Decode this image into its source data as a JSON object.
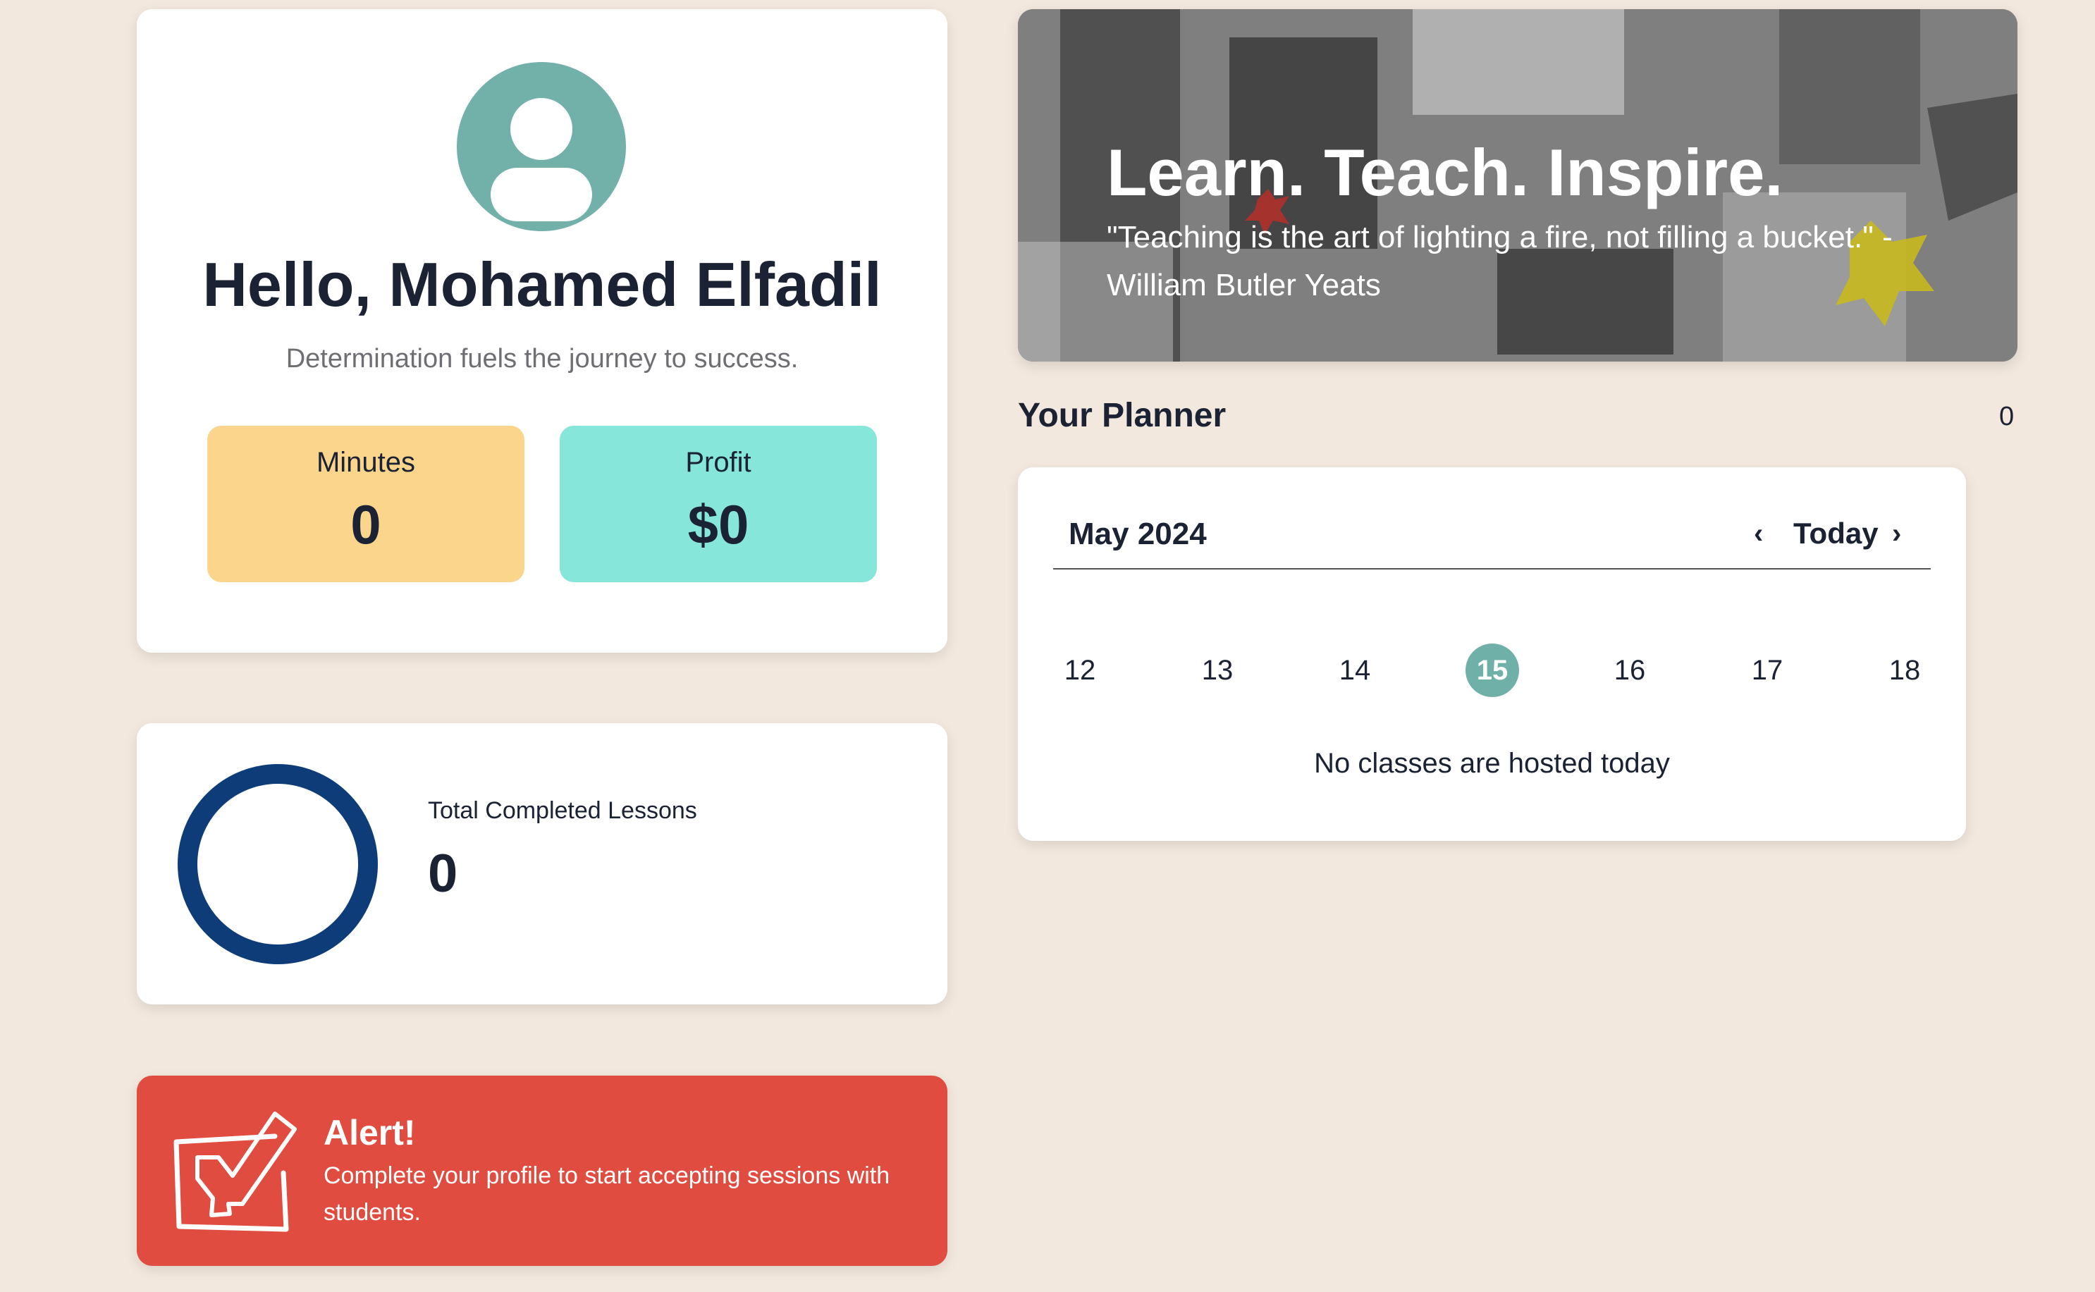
{
  "profile": {
    "greeting": "Hello, Mohamed Elfadil",
    "motto": "Determination fuels the journey to success.",
    "avatar_icon": "user-avatar-icon",
    "stats": [
      {
        "label": "Minutes",
        "value": "0",
        "color": "#fbd58c"
      },
      {
        "label": "Profit",
        "value": "$0",
        "color": "#86e6da"
      }
    ]
  },
  "lessons": {
    "title": "Total Completed Lessons",
    "value": "0",
    "progress": 0,
    "ring_color": "#0d3c78"
  },
  "alert": {
    "title": "Alert!",
    "text": "Complete your profile to start accepting sessions with students.",
    "icon": "edit-checkbox-icon",
    "color": "#e04d40"
  },
  "banner": {
    "title": "Learn. Teach. Inspire.",
    "quote": "\"Teaching is the art of lighting a fire, not filling a bucket.\" - William Butler Yeats"
  },
  "planner": {
    "title": "Your Planner",
    "count": "0",
    "calendar": {
      "month": "May 2024",
      "today_label": "Today",
      "prev_icon": "chevron-left-icon",
      "next_icon": "chevron-right-icon",
      "days": [
        "12",
        "13",
        "14",
        "15",
        "16",
        "17",
        "18"
      ],
      "selected_day": "15",
      "empty_message": "No classes are hosted today"
    }
  }
}
